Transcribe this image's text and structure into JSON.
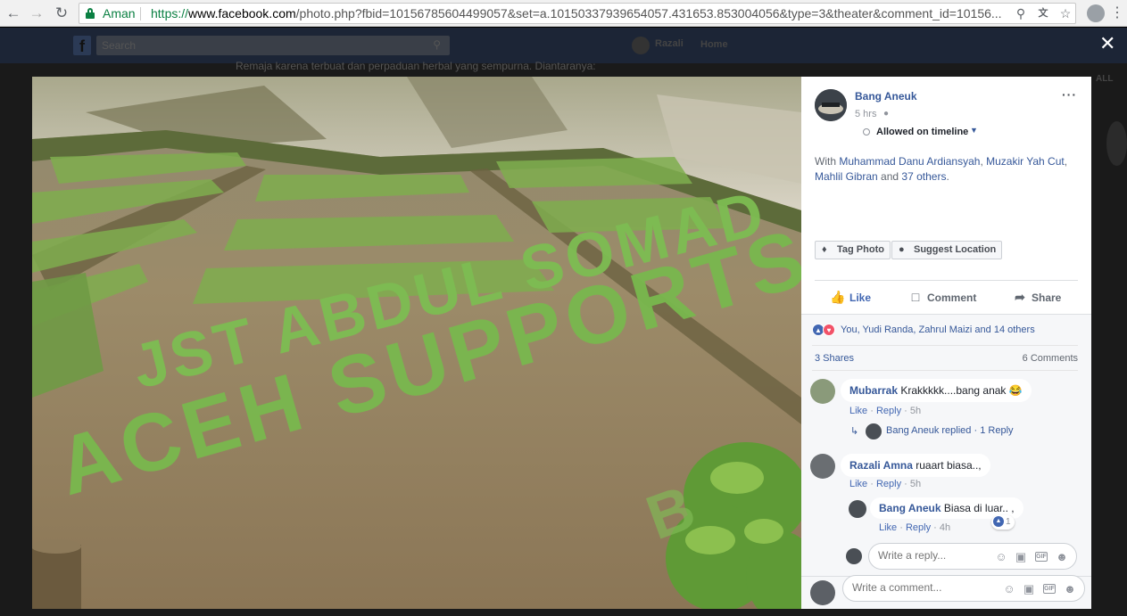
{
  "browser": {
    "back_icon": "arrow-left-icon",
    "forward_icon": "arrow-right-icon",
    "reload_icon": "reload-icon",
    "secure_label": "Aman",
    "url_scheme": "https://",
    "url_host": "www.facebook.com",
    "url_rest": "/photo.php?fbid=10156785604499057&set=a.10150337939654057.431653.853004056&type=3&theater&comment_id=10156...",
    "icons": [
      "search-icon",
      "translate-icon",
      "star-icon",
      "extension-icon",
      "menu-icon"
    ]
  },
  "fb_background": {
    "search_placeholder": "Search",
    "user_name": "Razali",
    "home_label": "Home",
    "bg_text": "Remaja karena terbuat dan perpaduan herbal yang sempurna. Diantaranya:",
    "see_all": "ALL"
  },
  "photo": {
    "line1": "JST ABDUL SOMAD",
    "line2": "ACEH SUPPORTS YOU",
    "line3": "B"
  },
  "post": {
    "author": "Bang Aneuk",
    "time": "5 hrs",
    "privacy_icon": "globe-icon",
    "timeline_status": "Allowed on timeline",
    "with_prefix": "With",
    "tagged": [
      "Muhammad Danu Ardiansyah",
      "Muzakir Yah Cut",
      "Mahlil Gibran"
    ],
    "and_text": "and",
    "others_link": "37 others",
    "others_suffix": ".",
    "separator_comma": ",",
    "tag_photo": "Tag Photo",
    "suggest_location": "Suggest Location"
  },
  "actions": {
    "like": "Like",
    "comment": "Comment",
    "share": "Share"
  },
  "stats": {
    "reactions_text": "You, Yudi Randa, Zahrul Maizi and 14 others",
    "shares": "3 Shares",
    "comments": "6 Comments"
  },
  "comments": [
    {
      "author": "Mubarrak",
      "text": "Krakkkkk....bang anak 😂",
      "like": "Like",
      "reply": "Reply",
      "time": "5h",
      "reply_summary": {
        "author": "Bang Aneuk",
        "text": "Bang Aneuk replied",
        "count": "1 Reply"
      }
    },
    {
      "author": "Razali Amna",
      "text": "ruaart biasa..,",
      "like": "Like",
      "reply": "Reply",
      "time": "5h",
      "replies": [
        {
          "author": "Bang Aneuk",
          "text": "Biasa di luar.. ,",
          "like": "Like",
          "reply": "Reply",
          "time": "4h",
          "like_count": "1"
        }
      ]
    }
  ],
  "reply_input": {
    "placeholder": "Write a reply..."
  },
  "comment_input": {
    "placeholder": "Write a comment..."
  },
  "meta_sep": "·",
  "colors": {
    "link": "#365899",
    "like_blue": "#4267b2",
    "secure_green": "#0b8043",
    "love_red": "#f25268"
  }
}
